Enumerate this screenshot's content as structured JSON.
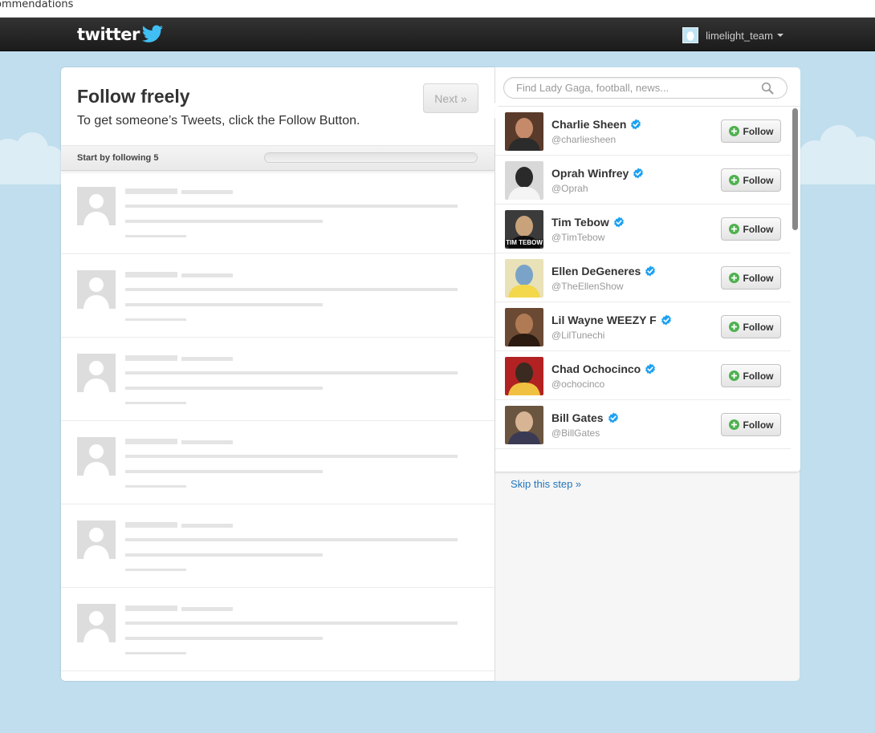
{
  "browser": {
    "tab_text": "ommendations"
  },
  "header": {
    "logo_text": "twitter",
    "account_name": "limelight_team"
  },
  "left": {
    "title": "Follow freely",
    "subtitle": "To get someone’s Tweets, click the Follow Button.",
    "next_label": "Next »",
    "progress_label": "Start by following 5",
    "progress_fraction": 0,
    "placeholder_rows": 6
  },
  "right": {
    "search_placeholder": "Find Lady Gaga, football, news...",
    "follow_label": "Follow",
    "skip_label": "Skip this step »",
    "users": [
      {
        "name": "Charlie Sheen",
        "handle": "@charliesheen",
        "verified": true
      },
      {
        "name": "Oprah Winfrey",
        "handle": "@Oprah",
        "verified": true
      },
      {
        "name": "Tim Tebow",
        "handle": "@TimTebow",
        "verified": true,
        "avatar_text": "TIM TEBOW"
      },
      {
        "name": "Ellen DeGeneres",
        "handle": "@TheEllenShow",
        "verified": true
      },
      {
        "name": "Lil Wayne WEEZY F",
        "handle": "@LilTunechi",
        "verified": true
      },
      {
        "name": "Chad Ochocinco",
        "handle": "@ochocinco",
        "verified": true
      },
      {
        "name": "Bill Gates",
        "handle": "@BillGates",
        "verified": true
      }
    ]
  },
  "colors": {
    "background": "#c0deed",
    "link": "#2276bb",
    "verified": "#1da1f2",
    "follow_plus": "#4fb14f"
  }
}
